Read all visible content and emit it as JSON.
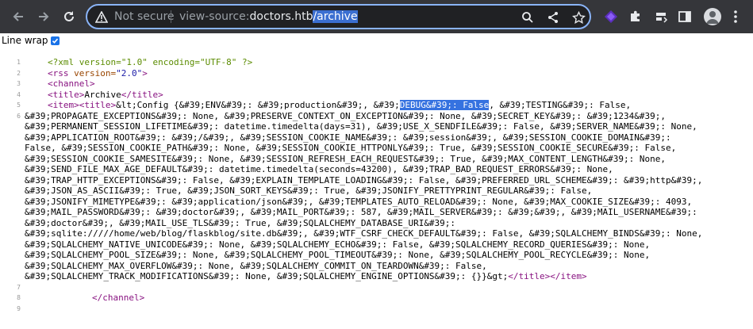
{
  "browser": {
    "security_label": "Not secure",
    "url_protocol": "view-source:",
    "url_host": "doctors.htb",
    "url_path": "/archive"
  },
  "viewer": {
    "line_wrap_label": "Line wrap",
    "line_wrap_checked": true
  },
  "source": {
    "line_numbers": [
      "1",
      "2",
      "3",
      "4",
      "5",
      "6",
      "7",
      "8",
      "9"
    ],
    "l1": "<?xml version=\"1.0\" encoding=\"UTF-8\" ?>",
    "l2_tag": "<rss",
    "l2_attr": " version=",
    "l2_val": "\"2.0\"",
    "l2_close": ">",
    "l3": "<channel>",
    "l4_open": "<title>",
    "l4_text": "Archive",
    "l4_close": "</title>",
    "l5_tags": "<item><title>",
    "l5_text_a": "&lt;Config {&#39;ENV&#39;: &#39;production&#39;, &#39;",
    "l5_highlight": "DEBUG&#39;: False",
    "l5_text_b": ", &#39;TESTING&#39;: False,",
    "wrap_lines": [
      "&#39;PROPAGATE_EXCEPTIONS&#39;: None, &#39;PRESERVE_CONTEXT_ON_EXCEPTION&#39;: None, &#39;SECRET_KEY&#39;: &#39;1234&#39;,",
      "&#39;PERMANENT_SESSION_LIFETIME&#39;: datetime.timedelta(days=31), &#39;USE_X_SENDFILE&#39;: False, &#39;SERVER_NAME&#39;: None,",
      "&#39;APPLICATION_ROOT&#39;: &#39;/&#39;, &#39;SESSION_COOKIE_NAME&#39;: &#39;session&#39;, &#39;SESSION_COOKIE_DOMAIN&#39;:",
      "False, &#39;SESSION_COOKIE_PATH&#39;: None, &#39;SESSION_COOKIE_HTTPONLY&#39;: True, &#39;SESSION_COOKIE_SECURE&#39;: False,",
      "&#39;SESSION_COOKIE_SAMESITE&#39;: None, &#39;SESSION_REFRESH_EACH_REQUEST&#39;: True, &#39;MAX_CONTENT_LENGTH&#39;: None,",
      "&#39;SEND_FILE_MAX_AGE_DEFAULT&#39;: datetime.timedelta(seconds=43200), &#39;TRAP_BAD_REQUEST_ERRORS&#39;: None,",
      "&#39;TRAP_HTTP_EXCEPTIONS&#39;: False, &#39;EXPLAIN_TEMPLATE_LOADING&#39;: False, &#39;PREFERRED_URL_SCHEME&#39;: &#39;http&#39;,",
      "&#39;JSON_AS_ASCII&#39;: True, &#39;JSON_SORT_KEYS&#39;: True, &#39;JSONIFY_PRETTYPRINT_REGULAR&#39;: False,",
      "&#39;JSONIFY_MIMETYPE&#39;: &#39;application/json&#39;, &#39;TEMPLATES_AUTO_RELOAD&#39;: None, &#39;MAX_COOKIE_SIZE&#39;: 4093,",
      "&#39;MAIL_PASSWORD&#39;: &#39;doctor&#39;, &#39;MAIL_PORT&#39;: 587, &#39;MAIL_SERVER&#39;: &#39;&#39;, &#39;MAIL_USERNAME&#39;:",
      "&#39;doctor&#39;, &#39;MAIL_USE_TLS&#39;: True, &#39;SQLALCHEMY_DATABASE_URI&#39;:",
      "&#39;sqlite://///home/web/blog/flaskblog/site.db&#39;, &#39;WTF_CSRF_CHECK_DEFAULT&#39;: False, &#39;SQLALCHEMY_BINDS&#39;: None,",
      "&#39;SQLALCHEMY_NATIVE_UNICODE&#39;: None, &#39;SQLALCHEMY_ECHO&#39;: False, &#39;SQLALCHEMY_RECORD_QUERIES&#39;: None,",
      "&#39;SQLALCHEMY_POOL_SIZE&#39;: None, &#39;SQLALCHEMY_POOL_TIMEOUT&#39;: None, &#39;SQLALCHEMY_POOL_RECYCLE&#39;: None,",
      "&#39;SQLALCHEMY_MAX_OVERFLOW&#39;: None, &#39;SQLALCHEMY_COMMIT_ON_TEARDOWN&#39;: False,"
    ],
    "last_wrap_text": "&#39;SQLALCHEMY_TRACK_MODIFICATIONS&#39;: None, &#39;SQLALCHEMY_ENGINE_OPTIONS&#39;: {}}&gt;",
    "last_wrap_tags": "</title></item>",
    "l8": "</channel>"
  },
  "colors": {
    "toolbar": "#35363a",
    "omnibox_border": "#8ab4f8",
    "selection": "#3572e0",
    "tag": "#881280"
  }
}
